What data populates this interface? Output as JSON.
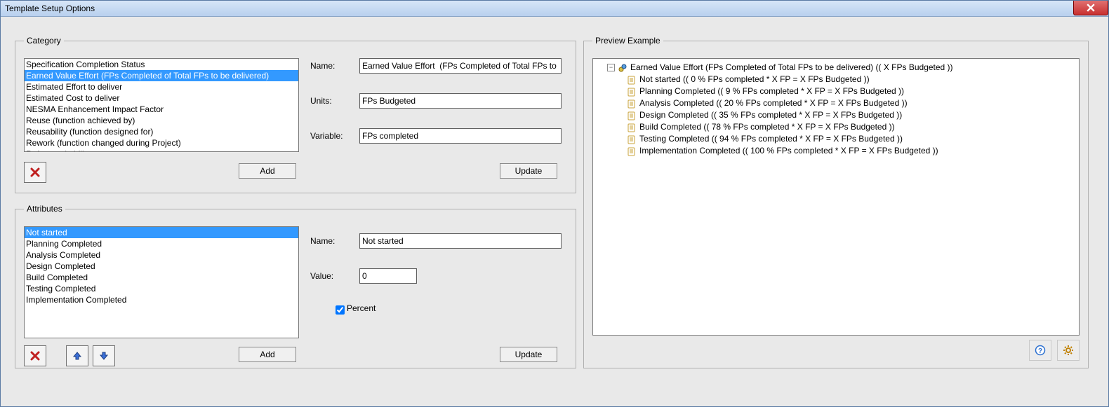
{
  "window": {
    "title": "Template Setup Options"
  },
  "category": {
    "legend": "Category",
    "items": [
      "Specification Completion Status",
      "Earned Value Effort  (FPs Completed of Total FPs to be delivered)",
      "Estimated Effort to deliver",
      "Estimated Cost to deliver",
      "NESMA Enhancement Impact Factor",
      "Reuse (function achieved by)",
      "Reusability (function designed for)",
      "Rework (function changed during Project)",
      "Reform suitability"
    ],
    "selected_index": 1,
    "name_label": "Name:",
    "name_value": "Earned Value Effort  (FPs Completed of Total FPs to be delivered)",
    "units_label": "Units:",
    "units_value": "FPs Budgeted",
    "variable_label": "Variable:",
    "variable_value": "FPs completed",
    "add_label": "Add",
    "update_label": "Update"
  },
  "attributes": {
    "legend": "Attributes",
    "items": [
      "Not started",
      "Planning Completed",
      "Analysis Completed",
      "Design Completed",
      "Build Completed",
      "Testing  Completed",
      "Implementation Completed"
    ],
    "selected_index": 0,
    "name_label": "Name:",
    "name_value": "Not started",
    "value_label": "Value:",
    "value_value": "0",
    "percent_label": "Percent",
    "percent_checked": true,
    "add_label": "Add",
    "update_label": "Update"
  },
  "preview": {
    "legend": "Preview Example",
    "root": "Earned Value Effort  (FPs Completed of Total FPs to be delivered)   (( X  FPs Budgeted ))",
    "children": [
      "Not started   (( 0 % FPs completed * X FP = X FPs Budgeted ))",
      "Planning Completed   (( 9 % FPs completed * X FP = X FPs Budgeted ))",
      "Analysis Completed   (( 20 % FPs completed * X FP = X FPs Budgeted ))",
      "Design Completed   (( 35 % FPs completed * X FP = X FPs Budgeted ))",
      "Build Completed   (( 78 % FPs completed * X FP = X FPs Budgeted ))",
      "Testing  Completed   (( 94 % FPs completed * X FP = X FPs Budgeted ))",
      "Implementation Completed   (( 100 % FPs completed * X FP = X FPs Budgeted ))"
    ]
  }
}
